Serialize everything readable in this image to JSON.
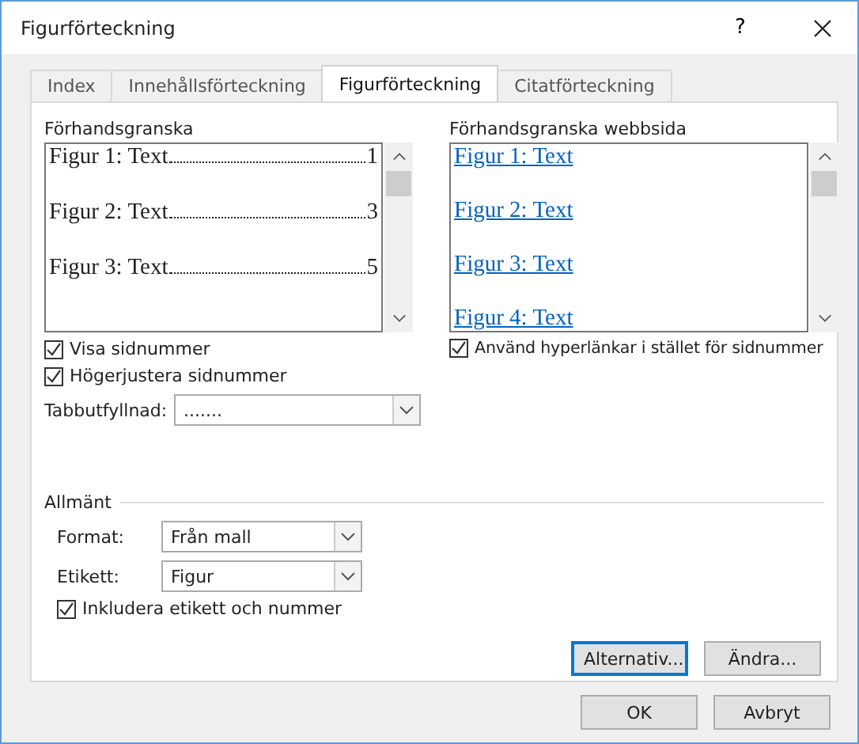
{
  "window": {
    "title": "Figurförteckning",
    "help": "?"
  },
  "tabs": [
    {
      "label": "Index",
      "selected": false
    },
    {
      "label": "Innehållsförteckning",
      "selected": false
    },
    {
      "label": "Figurförteckning",
      "selected": true
    },
    {
      "label": "Citatförteckning",
      "selected": false
    }
  ],
  "print_preview": {
    "label": "Förhandsgranska",
    "entries": [
      {
        "label": "Figur 1: Text",
        "page": "1"
      },
      {
        "label": "Figur 2: Text",
        "page": "3"
      },
      {
        "label": "Figur 3: Text",
        "page": "5"
      }
    ]
  },
  "web_preview": {
    "label": "Förhandsgranska webbsida",
    "entries": [
      "Figur 1: Text",
      "Figur 2: Text",
      "Figur 3: Text",
      "Figur 4: Text"
    ]
  },
  "left_options": [
    {
      "label": "Visa sidnummer",
      "checked": true
    },
    {
      "label": "Högerjustera sidnummer",
      "checked": true
    }
  ],
  "tab_leader": {
    "label": "Tabbutfyllnad:",
    "value": "......."
  },
  "web_option": {
    "label": "Använd hyperlänkar i stället för sidnummer",
    "checked": true
  },
  "general": {
    "title": "Allmänt",
    "fields": [
      {
        "label": "Format:",
        "value": "Från mall"
      },
      {
        "label": "Etikett:",
        "value": "Figur"
      }
    ],
    "include": {
      "label": "Inkludera etikett och nummer",
      "checked": true
    }
  },
  "panel_buttons": [
    {
      "label": "Alternativ...",
      "focused": true
    },
    {
      "label": "Ändra...",
      "focused": false
    }
  ],
  "buttons": [
    "OK",
    "Avbryt"
  ]
}
